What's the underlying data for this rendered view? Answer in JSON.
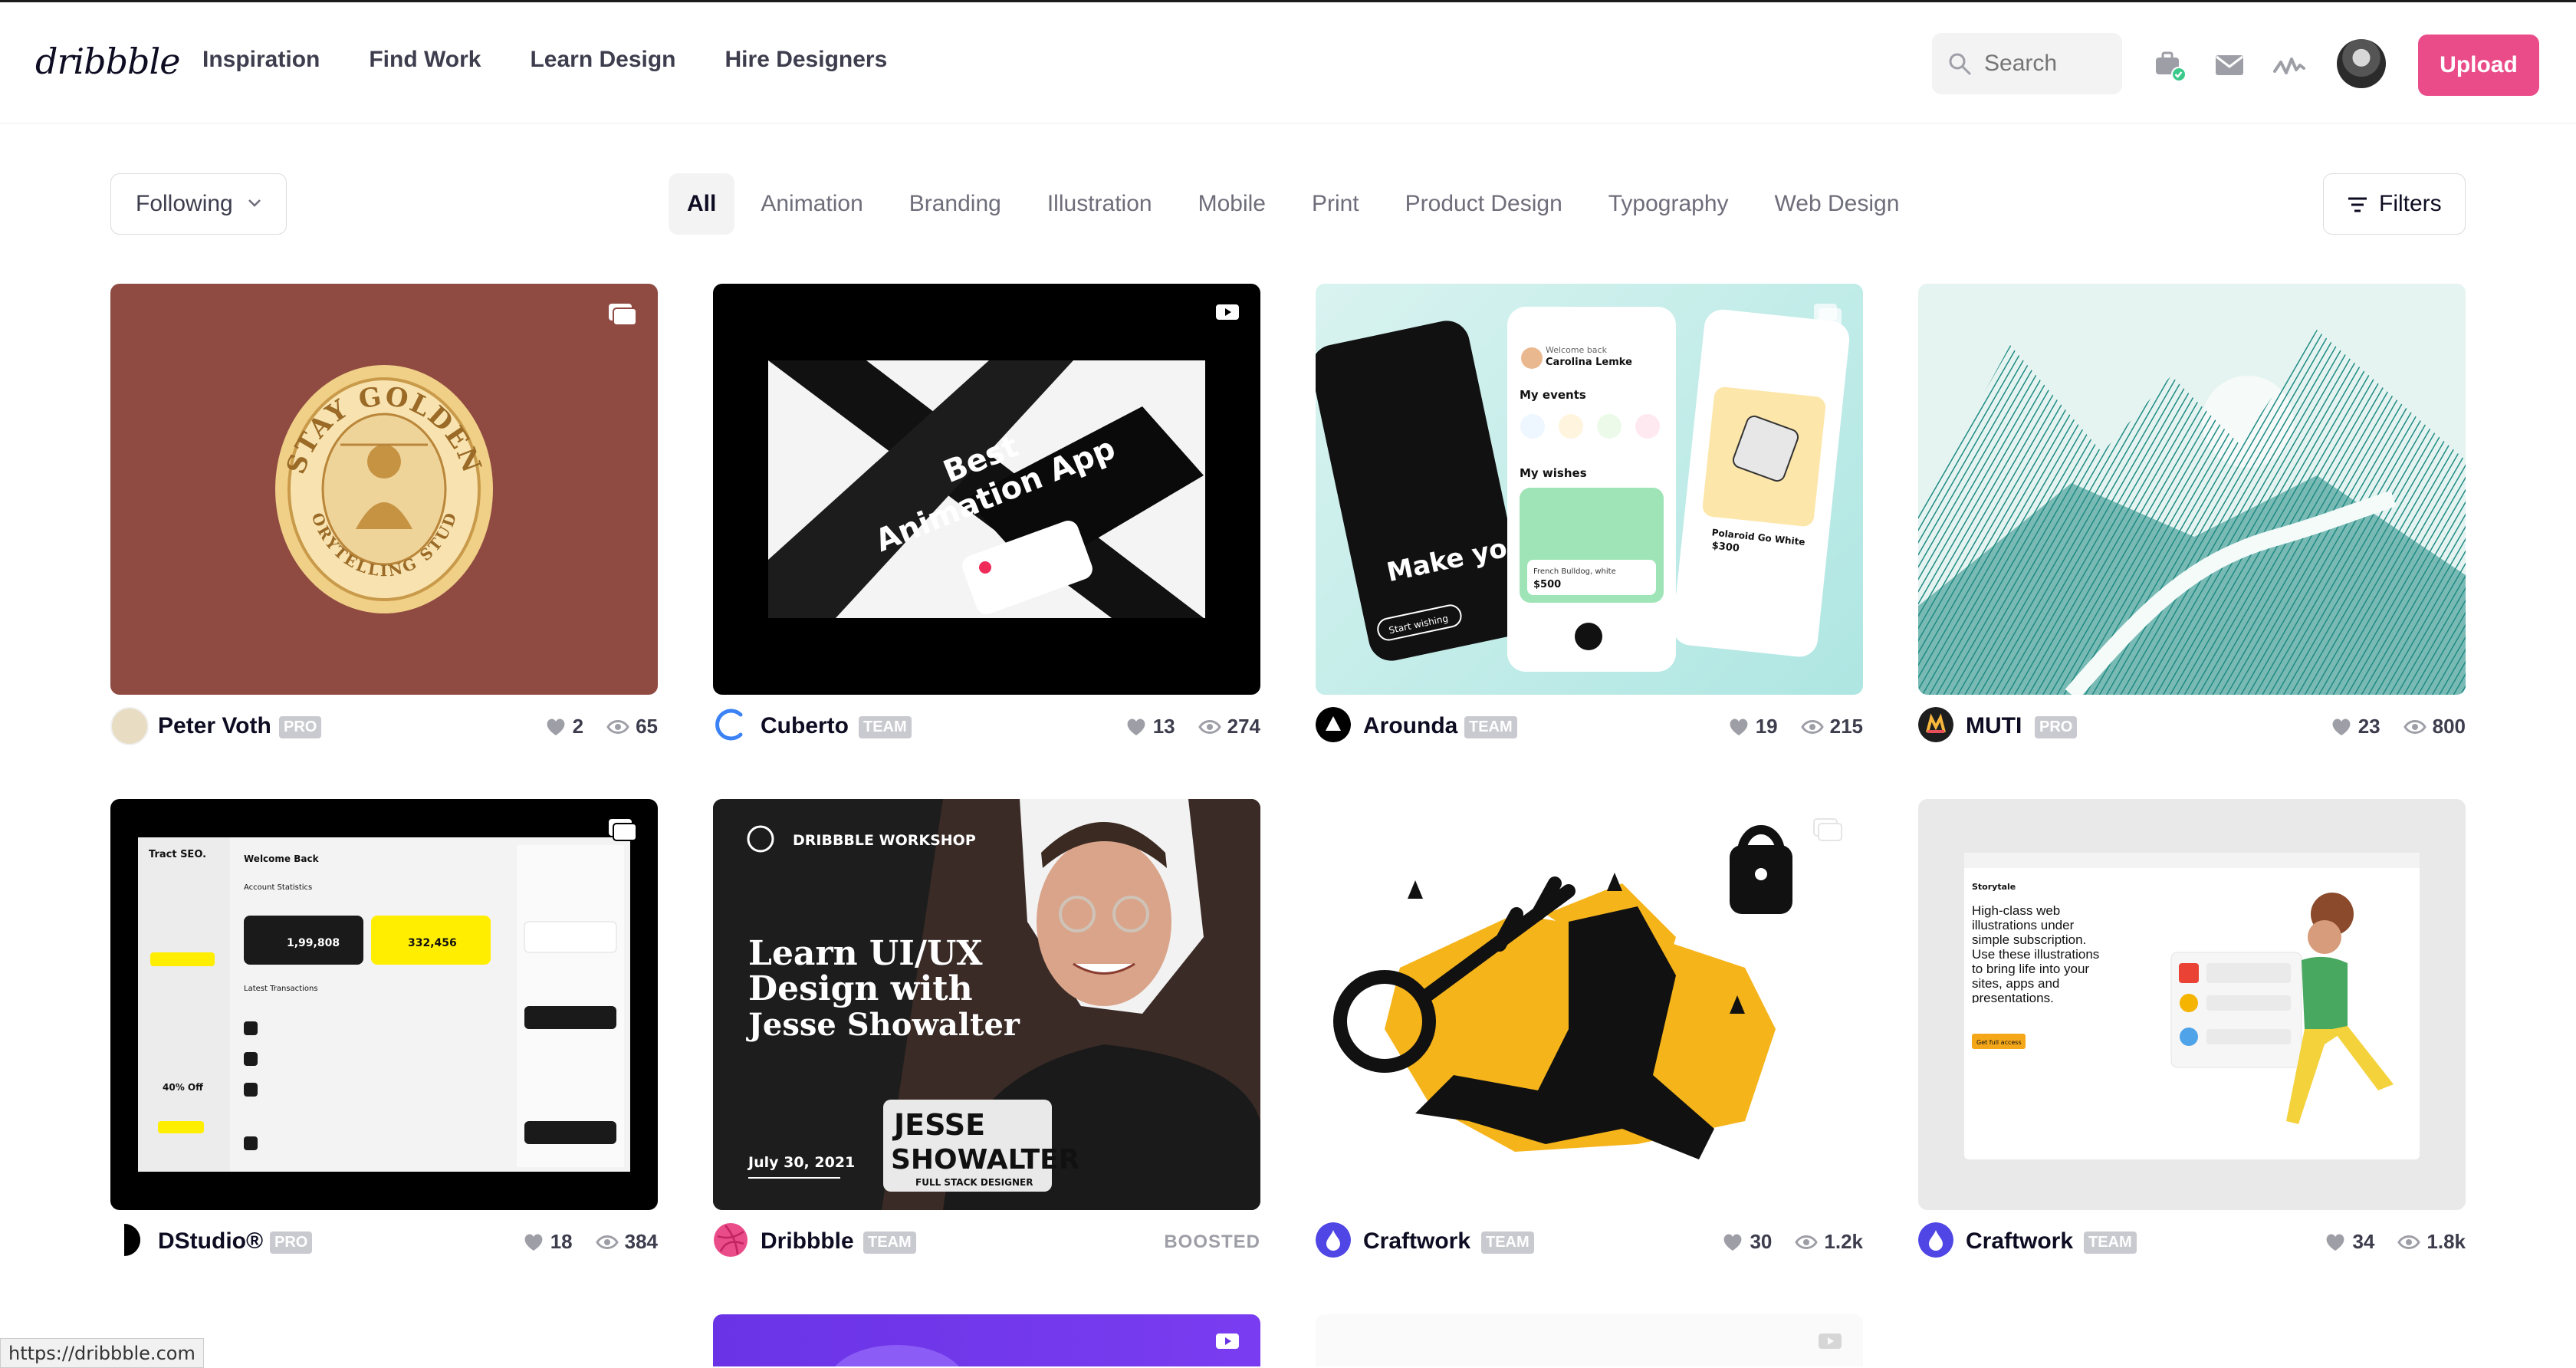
{
  "header": {
    "logo": "dribbble",
    "nav": [
      "Inspiration",
      "Find Work",
      "Learn Design",
      "Hire Designers"
    ],
    "search_placeholder": "Search",
    "upload_label": "Upload"
  },
  "filter_bar": {
    "following_label": "Following",
    "categories": [
      "All",
      "Animation",
      "Branding",
      "Illustration",
      "Mobile",
      "Print",
      "Product Design",
      "Typography",
      "Web Design"
    ],
    "active_category": "All",
    "filters_label": "Filters"
  },
  "shots": [
    {
      "author": "Peter Voth",
      "tag": "PRO",
      "likes": "2",
      "views": "65",
      "art_text": [
        "STAY GOLDEN",
        "STORYTELLING STUDIO"
      ]
    },
    {
      "author": "Cuberto",
      "tag": "TEAM",
      "likes": "13",
      "views": "274",
      "art_text": [
        "Best",
        "Animation App"
      ]
    },
    {
      "author": "Arounda",
      "tag": "TEAM",
      "likes": "19",
      "views": "215",
      "art_text": [
        "Welcome back",
        "Carolina Lemke",
        "My events",
        "My wishes",
        "Make your wish",
        "French Bulldog, white",
        "$500",
        "Polaroid Go White",
        "$300",
        "Start wishing"
      ]
    },
    {
      "author": "MUTI",
      "tag": "PRO",
      "likes": "23",
      "views": "800",
      "art_text": []
    },
    {
      "author": "DStudio®",
      "tag": "PRO",
      "likes": "18",
      "views": "384",
      "art_text": [
        "Tract SEO.",
        "Welcome Back",
        "Account Statistics",
        "1,99,808",
        "332,456",
        "Latest Transactions",
        "40% Off"
      ]
    },
    {
      "author": "Dribbble",
      "tag": "TEAM",
      "boosted": "BOOSTED",
      "art_text": [
        "DRIBBBLE WORKSHOP",
        "Learn UI/UX",
        "Design with",
        "Jesse Showalter",
        "July 30, 2021",
        "JESSE",
        "SHOWALTER",
        "FULL STACK DESIGNER"
      ]
    },
    {
      "author": "Craftwork",
      "tag": "TEAM",
      "likes": "30",
      "views": "1.2k",
      "art_text": []
    },
    {
      "author": "Craftwork",
      "tag": "TEAM",
      "likes": "34",
      "views": "1.8k",
      "art_text": [
        "Storytale",
        "High-class web illustrations under simple subscription. Use these illustrations to bring life into your sites, apps and presentations.",
        "Get full access"
      ]
    }
  ],
  "status_bar": {
    "url": "https://dribbble.com"
  },
  "colors": {
    "brand_pink": "#ea4c89",
    "text_dark": "#0d0c22",
    "muted": "#6e6d7a"
  }
}
